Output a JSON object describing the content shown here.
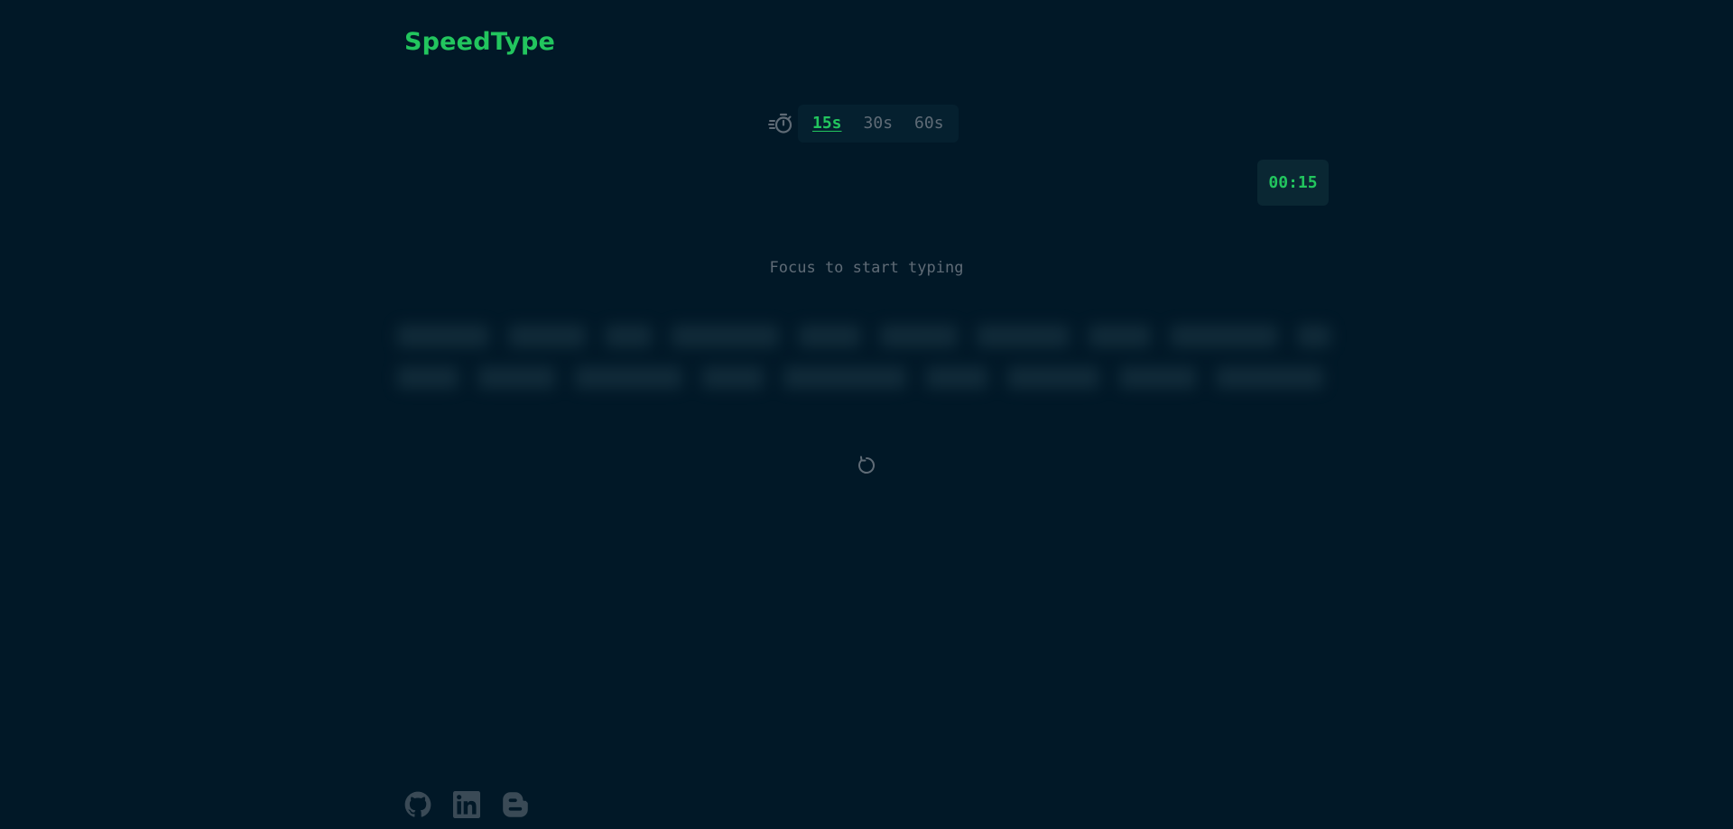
{
  "app": {
    "title": "SpeedType"
  },
  "duration": {
    "icon": "timer-icon",
    "options": [
      {
        "label": "15s",
        "active": true
      },
      {
        "label": "30s",
        "active": false
      },
      {
        "label": "60s",
        "active": false
      }
    ]
  },
  "timer": {
    "display": "00:15"
  },
  "hint": {
    "text": "Focus to start typing"
  },
  "restart": {
    "icon": "restart-icon"
  },
  "footer": {
    "links": [
      {
        "icon": "github-icon"
      },
      {
        "icon": "linkedin-icon"
      },
      {
        "icon": "blogger-icon"
      }
    ]
  },
  "colors": {
    "background": "#011827",
    "accent": "#22c55e",
    "muted": "#5f6b76",
    "panel": "#0a2733"
  }
}
